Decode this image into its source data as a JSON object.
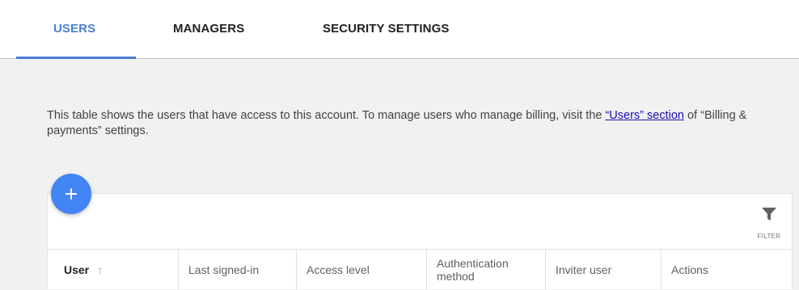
{
  "tabs": [
    {
      "label": "USERS",
      "active": true
    },
    {
      "label": "MANAGERS",
      "active": false
    },
    {
      "label": "SECURITY SETTINGS",
      "active": false
    }
  ],
  "intro": {
    "text_before": "This table shows the users that have access to this account. To manage users who manage billing, visit the ",
    "link_text": "“Users” section",
    "text_after": " of “Billing & payments” settings."
  },
  "fab": {
    "icon": "plus-icon"
  },
  "filter": {
    "label": "FILTER",
    "icon": "filter-funnel-icon"
  },
  "table": {
    "columns": [
      {
        "label": "User",
        "sort": "ascending"
      },
      {
        "label": "Last signed-in"
      },
      {
        "label": "Access level"
      },
      {
        "label": "Authentication method"
      },
      {
        "label": "Inviter user"
      },
      {
        "label": "Actions"
      }
    ],
    "sort_arrow": "↑"
  },
  "colors": {
    "accent": "#4a7fd6",
    "fab": "#4285f4",
    "link": "#1a0dab",
    "page_background": "#f1f1f1"
  }
}
